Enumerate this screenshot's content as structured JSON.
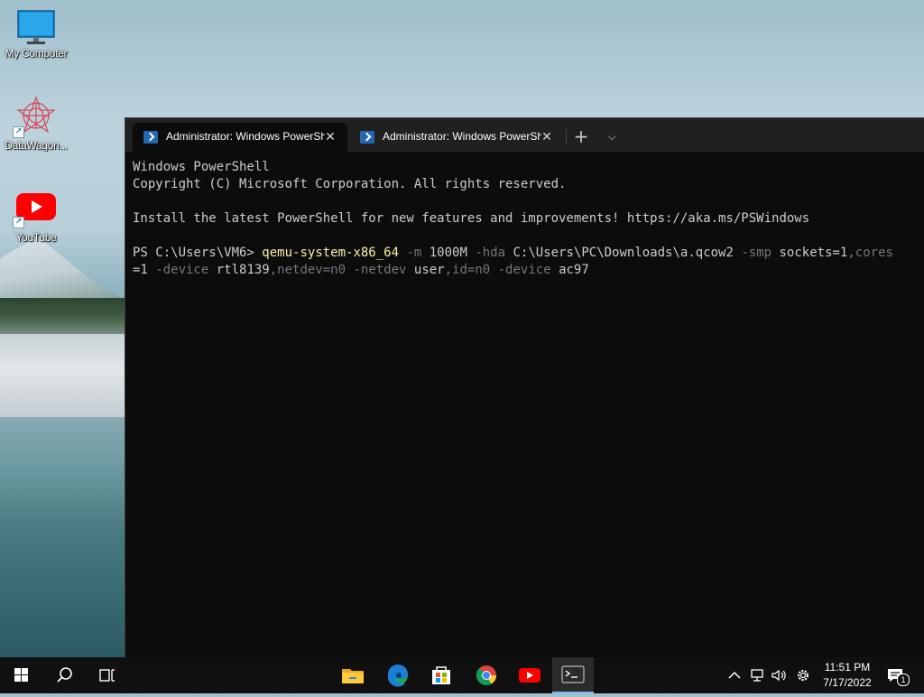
{
  "desktop": {
    "icons": [
      {
        "label": "My Computer"
      },
      {
        "label": "DataWagon..."
      },
      {
        "label": "YouTube"
      }
    ]
  },
  "terminal": {
    "tabs": [
      {
        "title": "Administrator: Windows PowerShell",
        "close": "✕"
      },
      {
        "title": "Administrator: Windows PowerShell",
        "close": "✕"
      }
    ],
    "new_tab": "+",
    "dropdown": "⌵",
    "lines": {
      "l1": "Windows PowerShell",
      "l2": "Copyright (C) Microsoft Corporation. All rights reserved.",
      "l4": "Install the latest PowerShell for new features and improvements! https://aka.ms/PSWindows",
      "prompt": "PS C:\\Users\\VM6> ",
      "cmd": "qemu-system-x86_64",
      "p_m": " -m",
      "v_m": " 1000M",
      "p_hda": " -hda",
      "v_hda": " C:\\Users\\PC\\Downloads\\a.qcow2",
      "p_smp": " -smp",
      "v_smp": " sockets=1",
      "v_smp_rest": ",cores",
      "wrap_v": "=1",
      "p_dev1": " -device",
      "v_dev1a": " rtl8139",
      "v_dev1b": ",netdev=n0",
      "p_netdev": " -netdev",
      "v_netdev_a": " user",
      "v_netdev_b": ",id=n0",
      "p_dev2": " -device",
      "v_dev2": " ac97"
    }
  },
  "taskbar": {
    "time": "11:51 PM",
    "date": "7/17/2022",
    "notification_count": "1"
  }
}
